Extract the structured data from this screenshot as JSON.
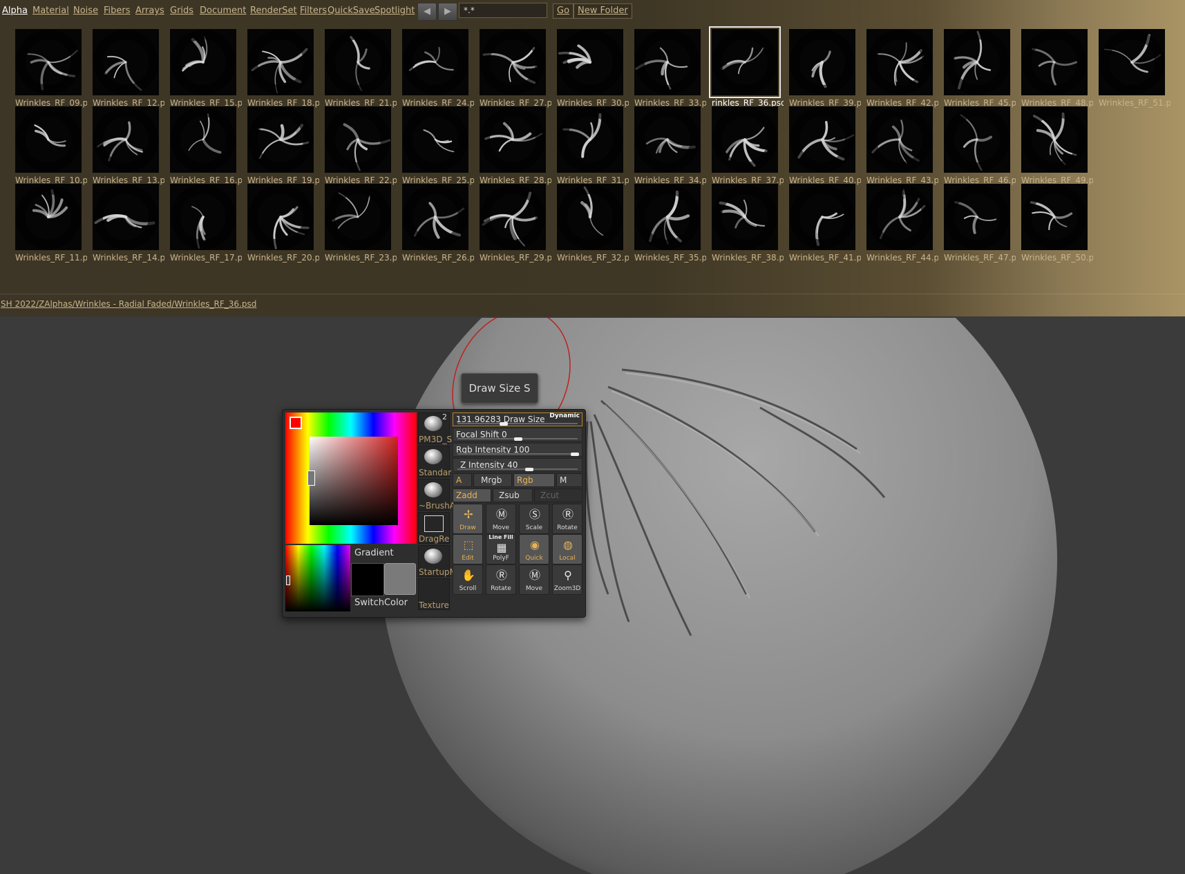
{
  "tabs": [
    "Alpha",
    "Material",
    "Noise",
    "Fibers",
    "Arrays",
    "Grids",
    "Document",
    "RenderSet",
    "Filters",
    "QuickSave",
    "Spotlight"
  ],
  "active_tab": "Alpha",
  "filter_value": "*.*",
  "go_label": "Go",
  "new_folder_label": "New Folder",
  "prev_icon": "◀",
  "next_icon": "▶",
  "thumbs": [
    [
      "Wrinkles_RF_09.p",
      "Wrinkles_RF_12.p",
      "Wrinkles_RF_15.p",
      "Wrinkles_RF_18.p",
      "Wrinkles_RF_21.p",
      "Wrinkles_RF_24.p",
      "Wrinkles_RF_27.p",
      "Wrinkles_RF_30.p",
      "Wrinkles_RF_33.p",
      "rinkles_RF_36.psd",
      "Wrinkles_RF_39.p",
      "Wrinkles_RF_42.p",
      "Wrinkles_RF_45.p",
      "Wrinkles_RF_48.p",
      "Wrinkles_RF_51.p"
    ],
    [
      "Wrinkles_RF_10.p",
      "Wrinkles_RF_13.p",
      "Wrinkles_RF_16.p",
      "Wrinkles_RF_19.p",
      "Wrinkles_RF_22.p",
      "Wrinkles_RF_25.p",
      "Wrinkles_RF_28.p",
      "Wrinkles_RF_31.p",
      "Wrinkles_RF_34.p",
      "Wrinkles_RF_37.p",
      "Wrinkles_RF_40.p",
      "Wrinkles_RF_43.p",
      "Wrinkles_RF_46.p",
      "Wrinkles_RF_49.p"
    ],
    [
      "Wrinkles_RF_11.p",
      "Wrinkles_RF_14.p",
      "Wrinkles_RF_17.p",
      "Wrinkles_RF_20.p",
      "Wrinkles_RF_23.p",
      "Wrinkles_RF_26.p",
      "Wrinkles_RF_29.p",
      "Wrinkles_RF_32.p",
      "Wrinkles_RF_35.p",
      "Wrinkles_RF_38.p",
      "Wrinkles_RF_41.p",
      "Wrinkles_RF_44.p",
      "Wrinkles_RF_47.p",
      "Wrinkles_RF_50.p"
    ]
  ],
  "selected_thumb": "rinkles_RF_36.psd",
  "path_text": "SH 2022/ZAlphas/Wrinkles - Radial Faded/Wrinkles_RF_36.psd",
  "tooltip": "Draw Size  S",
  "palette": {
    "gradient_label": "Gradient",
    "switch_color_label": "SwitchColor",
    "slot_captions": [
      "PM3D_S",
      "Standar",
      "~BrushA",
      "DragRe",
      "StartupM",
      "Texture"
    ],
    "slot_badge": "2",
    "sliders": [
      {
        "label": "131.96283 Draw Size",
        "value_fraction": 0.37,
        "badge": "Dynamic"
      },
      {
        "label": "Focal Shift 0",
        "value_fraction": 0.5
      },
      {
        "label": "Rgb Intensity 100",
        "value_fraction": 1.0
      },
      {
        "label": "Z Intensity 40",
        "value_fraction": 0.6
      }
    ],
    "toggles_row1": [
      "A",
      "Mrgb",
      "Rgb",
      "M"
    ],
    "toggles_row2": [
      "Zadd",
      "Zsub",
      "Zcut"
    ],
    "tools": [
      [
        "Draw",
        "Move",
        "Scale",
        "Rotate"
      ],
      [
        "Edit",
        "PolyF",
        "Quick",
        "Local"
      ],
      [
        "Scroll",
        "Rotate",
        "Move",
        "Zoom3D"
      ]
    ],
    "polyf_top": "Line Fill",
    "colors": {
      "accent": "#e6b35a",
      "highlight_border": "#b8862e"
    }
  }
}
